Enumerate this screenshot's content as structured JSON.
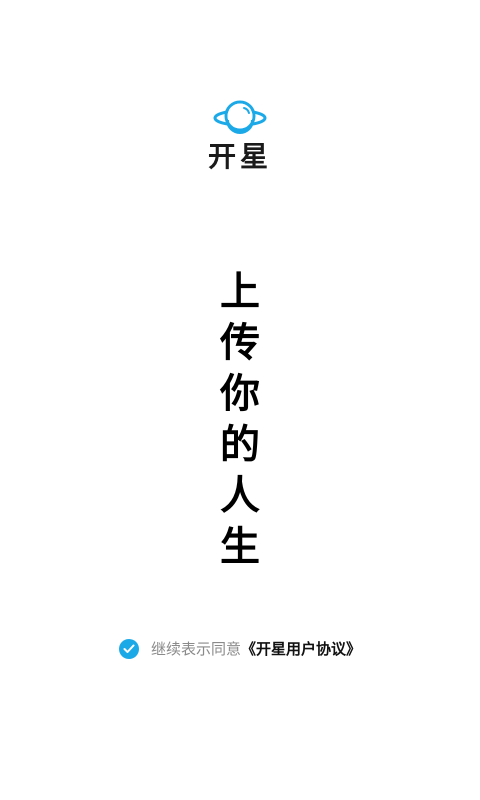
{
  "brand": {
    "name": "开星",
    "logo_icon": "planet-icon",
    "accent_color": "#1ca9e8"
  },
  "slogan": {
    "chars": [
      "上",
      "传",
      "你",
      "的",
      "人",
      "生"
    ]
  },
  "agreement": {
    "checked": true,
    "check_color": "#1ca9e8",
    "prefix": "继续表示同意",
    "link_text": "《开星用户协议》"
  }
}
